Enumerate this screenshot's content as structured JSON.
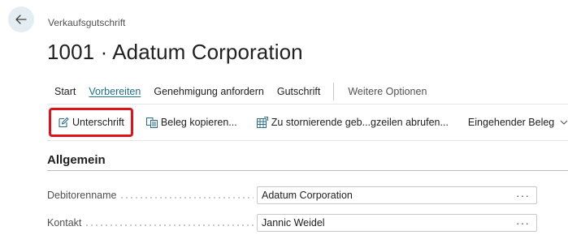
{
  "breadcrumb": "Verkaufsgutschrift",
  "title": "1001 · Adatum Corporation",
  "action_tabs": [
    "Start",
    "Vorbereiten",
    "Genehmigung anfordern",
    "Gutschrift"
  ],
  "more_options": "Weitere Optionen",
  "active_tab": "Vorbereiten",
  "ribbon": {
    "signature": "Unterschrift",
    "copy_document": "Beleg kopieren...",
    "storno_lines": "Zu stornierende geb...gzeilen abrufen...",
    "incoming_document": "Eingehender Beleg"
  },
  "section": {
    "title": "Allgemein",
    "fields": [
      {
        "label": "Debitorenname",
        "value": "Adatum Corporation"
      },
      {
        "label": "Kontakt",
        "value": "Jannic Weidel"
      }
    ],
    "lookup_glyph": "···"
  },
  "colors": {
    "accent": "#1f6f8b",
    "highlight_border": "#e0121a",
    "back_button_bg": "#e4eef2"
  }
}
